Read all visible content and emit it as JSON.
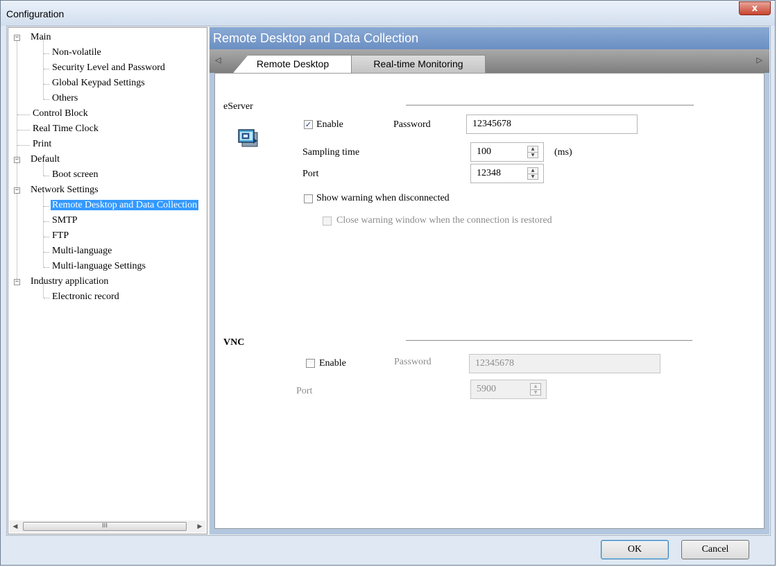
{
  "window": {
    "title": "Configuration",
    "close_glyph": "x"
  },
  "tree": {
    "items": [
      {
        "label": "Main",
        "expander": "−"
      },
      {
        "label": "Non-volatile"
      },
      {
        "label": "Security Level and Password"
      },
      {
        "label": "Global Keypad Settings"
      },
      {
        "label": "Others"
      },
      {
        "label": "Control Block"
      },
      {
        "label": "Real Time Clock"
      },
      {
        "label": "Print"
      },
      {
        "label": "Default",
        "expander": "−"
      },
      {
        "label": "Boot screen"
      },
      {
        "label": "Network Settings",
        "expander": "−"
      },
      {
        "label": "Remote Desktop and Data Collection"
      },
      {
        "label": "SMTP"
      },
      {
        "label": "FTP"
      },
      {
        "label": "Multi-language"
      },
      {
        "label": "Multi-language Settings"
      },
      {
        "label": "Industry application",
        "expander": "−"
      },
      {
        "label": "Electronic record"
      }
    ],
    "scroll_left": "◀",
    "scroll_right": "▶",
    "scroll_grip": "III"
  },
  "panel": {
    "title": "Remote Desktop and Data Collection",
    "tab_scroll_left": "◁",
    "tab_scroll_right": "▷",
    "tabs": [
      {
        "label": "Remote Desktop",
        "active": true
      },
      {
        "label": "Real-time Monitoring",
        "active": false
      }
    ]
  },
  "eserver": {
    "section_label": "eServer",
    "icon": "remote-desktop-icon",
    "enable_label": "Enable",
    "enable_checked": true,
    "password_label": "Password",
    "password_value": "12345678",
    "sampling_label": "Sampling time",
    "sampling_value": "100",
    "sampling_unit": "(ms)",
    "port_label": "Port",
    "port_value": "12348",
    "show_warning_label": "Show warning when disconnected",
    "show_warning_checked": false,
    "close_warning_label": "Close warning window when the connection is restored",
    "close_warning_checked": false
  },
  "vnc": {
    "section_label": "VNC",
    "enable_label": "Enable",
    "enable_checked": false,
    "password_label": "Password",
    "password_value": "12345678",
    "port_label": "Port",
    "port_value": "5900"
  },
  "spin_up": "▲",
  "spin_down": "▼",
  "check_mark": "✓",
  "buttons": {
    "ok": "OK",
    "cancel": "Cancel"
  }
}
